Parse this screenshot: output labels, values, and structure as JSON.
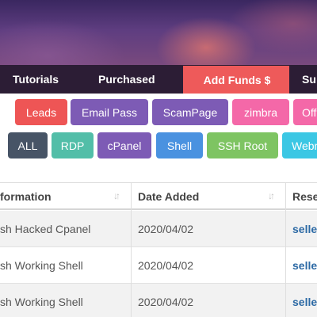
{
  "nav": {
    "tutorials": "Tutorials",
    "purchased": "Purchased",
    "add_funds": "Add Funds $",
    "support": "Su"
  },
  "categories": [
    {
      "label": "Leads",
      "color": "#ee5555"
    },
    {
      "label": "Email Pass",
      "color": "#7d5bb5"
    },
    {
      "label": "ScamPage",
      "color": "#7d5bb5"
    },
    {
      "label": "zimbra",
      "color": "#f468a8"
    },
    {
      "label": "Off",
      "color": "#f468a8"
    }
  ],
  "filters": [
    {
      "label": "ALL",
      "color": "#475466"
    },
    {
      "label": "RDP",
      "color": "#52bea8"
    },
    {
      "label": "cPanel",
      "color": "#7d5bb5"
    },
    {
      "label": "Shell",
      "color": "#4a92e0"
    },
    {
      "label": "SSH Root",
      "color": "#7ec462"
    },
    {
      "label": "Webm",
      "color": "#3bc7e4"
    }
  ],
  "table": {
    "headers": {
      "information": "formation",
      "date_added": "Date Added",
      "reseller": "Rese"
    },
    "rows": [
      {
        "information": "sh Hacked Cpanel",
        "date": "2020/04/02",
        "seller": "selle"
      },
      {
        "information": "sh Working Shell",
        "date": "2020/04/02",
        "seller": "selle"
      },
      {
        "information": "sh Working Shell",
        "date": "2020/04/02",
        "seller": "selle"
      }
    ]
  }
}
